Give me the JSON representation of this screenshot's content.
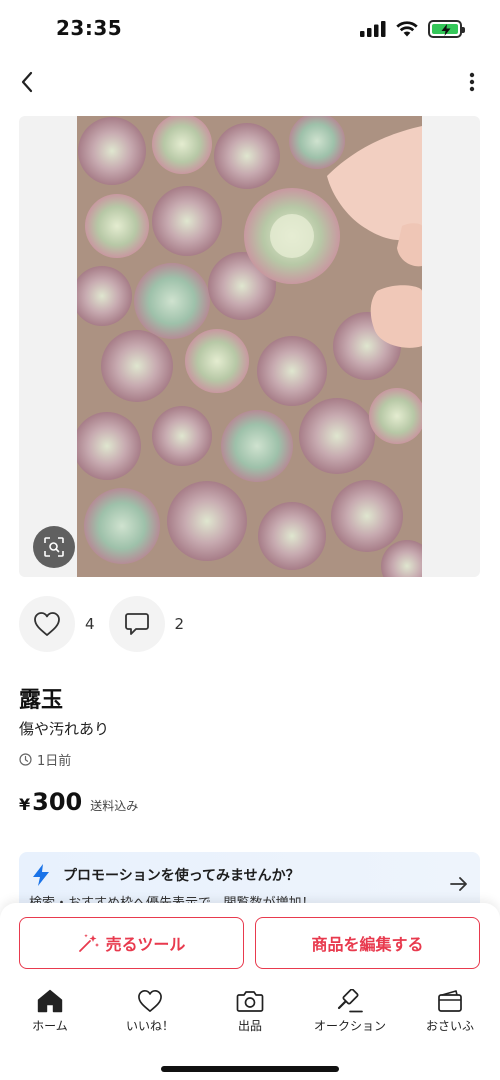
{
  "status": {
    "time": "23:35",
    "icons": [
      "cellular-signal-icon",
      "wifi-icon",
      "battery-charging-icon"
    ],
    "battery_color": "#34c759"
  },
  "nav": {
    "back_icon": "chevron-left-icon",
    "more_icon": "more-vertical-icon"
  },
  "product": {
    "image_subject": "pink-green succulent rosettes",
    "lens_icon": "image-search-icon",
    "likes": "4",
    "comments": "2",
    "title": "露玉",
    "condition": "傷や汚れあり",
    "posted": "1日前",
    "price_symbol": "¥",
    "price": "300",
    "shipping": "送料込み"
  },
  "promo": {
    "icon": "lightning-icon",
    "title": "プロモーションを使ってみませんか？",
    "subtitle": "検索・おすすめ枠へ優先表示で、閲覧数が増加！",
    "arrow_icon": "arrow-right-icon",
    "accent": "#1a73e8"
  },
  "actions": {
    "sell_tool": "売るツール",
    "edit_item": "商品を編集する",
    "accent": "#e83a4e"
  },
  "tabbar": [
    {
      "label": "ホーム",
      "icon": "home-icon",
      "active": true
    },
    {
      "label": "いいね！",
      "icon": "heart-icon",
      "active": false
    },
    {
      "label": "出品",
      "icon": "camera-icon",
      "active": false
    },
    {
      "label": "オークション",
      "icon": "gavel-icon",
      "active": false
    },
    {
      "label": "おさいふ",
      "icon": "wallet-icon",
      "active": false
    }
  ]
}
